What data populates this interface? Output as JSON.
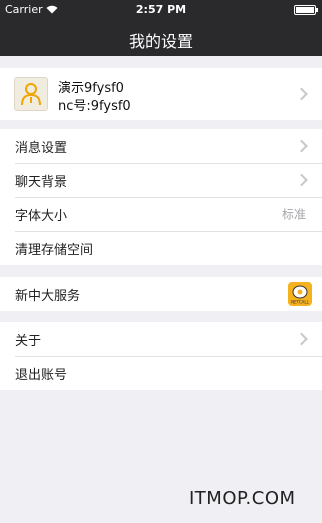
{
  "status_bar": {
    "carrier": "Carrier",
    "time": "2:57 PM"
  },
  "nav": {
    "title": "我的设置"
  },
  "profile": {
    "name": "演示9fysf0",
    "id_line": "nc号:9fysf0"
  },
  "settings": {
    "message": "消息设置",
    "chat_background": "聊天背景",
    "font_size": "字体大小",
    "font_size_value": "标准",
    "clear_storage": "清理存储空间"
  },
  "services": {
    "label": "新中大服务",
    "icon_text": "NETCALL"
  },
  "about": {
    "label": "关于"
  },
  "logout": {
    "label": "退出账号"
  },
  "watermark": "ITMOP.COM",
  "colors": {
    "topbar": "#2a2a2c",
    "background": "#efeff4",
    "service_icon": "#f5b21f"
  }
}
